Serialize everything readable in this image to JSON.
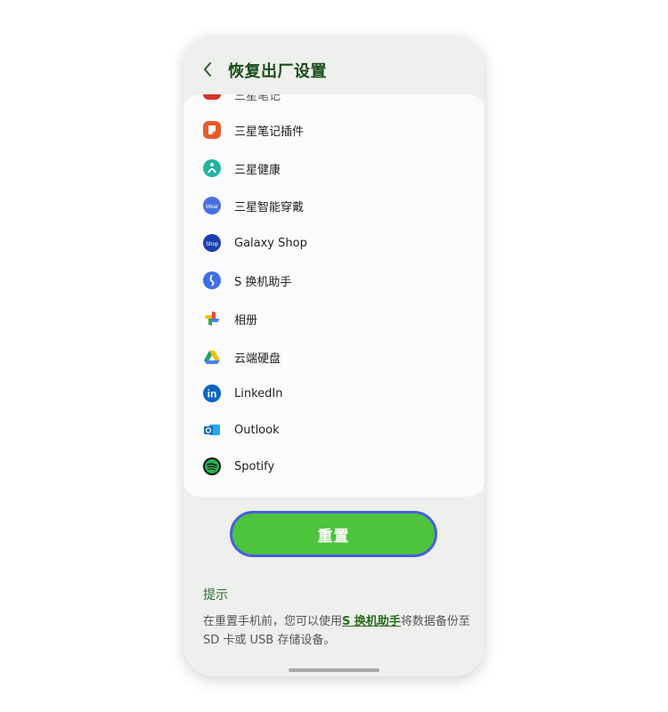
{
  "header": {
    "title": "恢复出厂设置",
    "back_icon": "chevron-left-icon"
  },
  "app_list": {
    "partial_item": "三星笔记",
    "items": [
      {
        "label": "三星笔记插件",
        "icon": "samsung-notes-addon-icon",
        "color": "#e85a2a"
      },
      {
        "label": "三星健康",
        "icon": "samsung-health-icon",
        "color": "#1fb5a0"
      },
      {
        "label": "三星智能穿戴",
        "icon": "galaxy-wearable-icon",
        "color": "#4a6ee0"
      },
      {
        "label": "Galaxy Shop",
        "icon": "galaxy-shop-icon",
        "color": "#1a3fae"
      },
      {
        "label": "S 换机助手",
        "icon": "smart-switch-icon",
        "color": "#3f6fe8"
      },
      {
        "label": "相册",
        "icon": "google-photos-icon",
        "color": "#ea4335"
      },
      {
        "label": "云端硬盘",
        "icon": "google-drive-icon",
        "color": "#1fa463"
      },
      {
        "label": "LinkedIn",
        "icon": "linkedin-icon",
        "color": "#0a66c2"
      },
      {
        "label": "Outlook",
        "icon": "outlook-icon",
        "color": "#0f6cbd"
      },
      {
        "label": "Spotify",
        "icon": "spotify-icon",
        "color": "#1db954"
      }
    ]
  },
  "reset_button": {
    "label": "重置"
  },
  "tips": {
    "heading": "提示",
    "text_before": "在重置手机前，您可以使用",
    "link": "S 换机助手",
    "text_after": "将数据备份至 SD 卡或 USB 存储设备。"
  },
  "colors": {
    "accent": "#4cc43c",
    "button_border": "#4a5de6",
    "title": "#1a4d1a",
    "background": "#edf0ed"
  }
}
